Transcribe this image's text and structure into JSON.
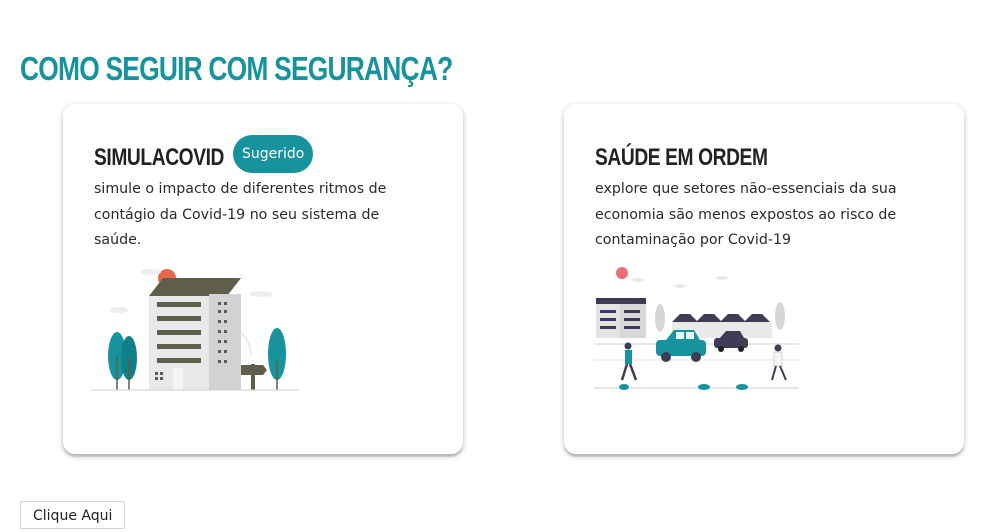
{
  "page": {
    "title": "COMO SEGUIR COM SEGURANÇA?",
    "accent_color": "#16939d"
  },
  "cards": [
    {
      "title": "SIMULACOVID",
      "badge": "Sugerido",
      "description": "simule o impacto de diferentes ritmos de contágio da Covid-19 no seu sistema de saúde.",
      "illustration": "hospital-building-illustration"
    },
    {
      "title": "SAÚDE EM ORDEM",
      "description": "explore que setores não-essenciais da sua economia são menos expostos ao risco de contaminação por Covid-19",
      "illustration": "city-street-illustration"
    }
  ],
  "action": {
    "button_label": "Clique Aqui"
  }
}
